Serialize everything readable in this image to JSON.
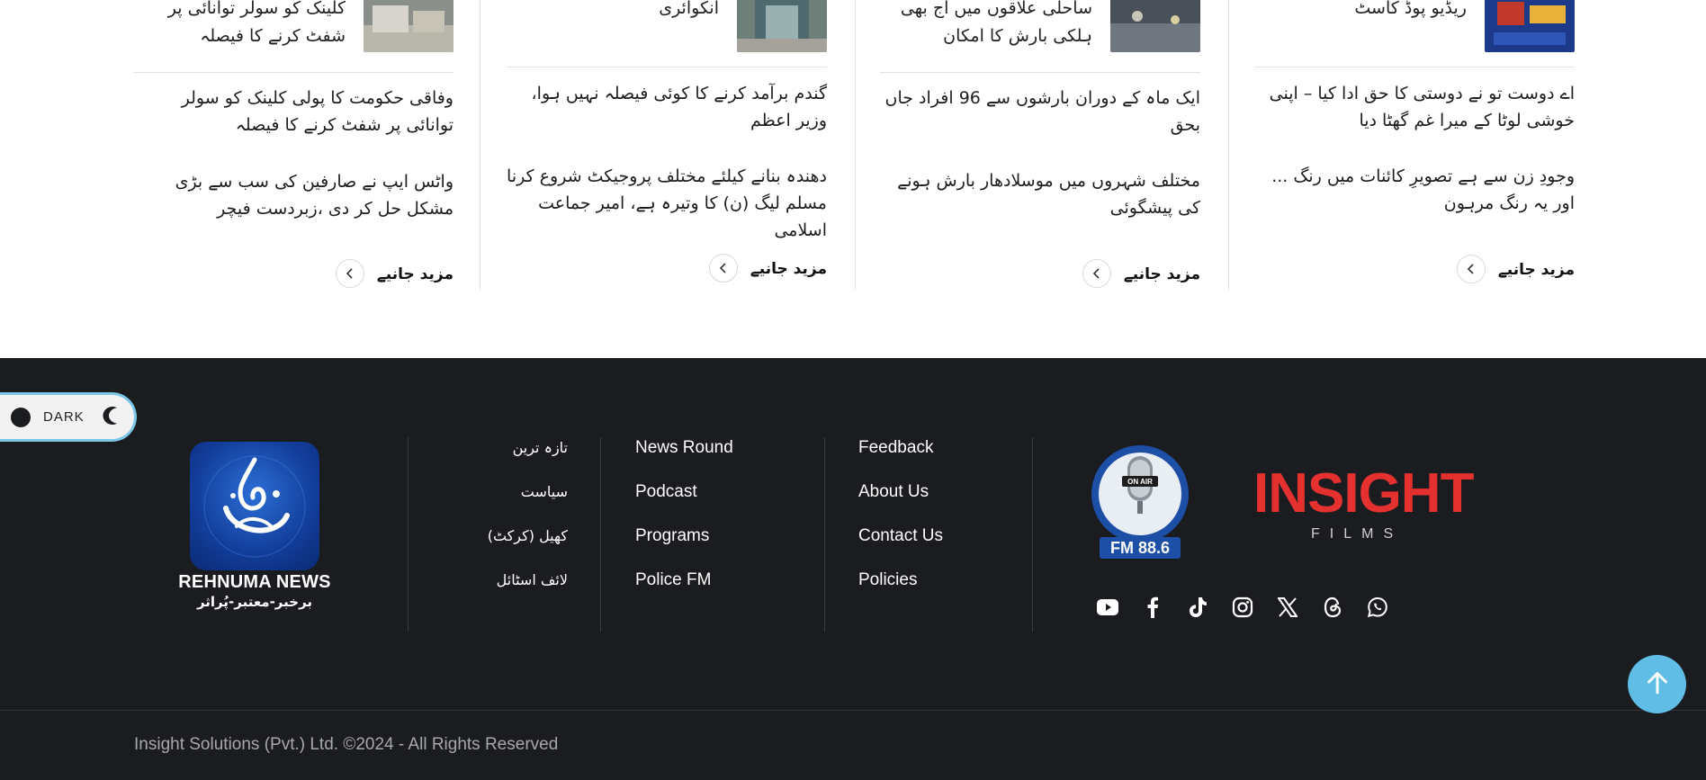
{
  "columns": [
    {
      "top_title": "کلینک کو سولر توانائی پر شفٹ کرنے کا فیصلہ",
      "stories": [
        "وفاقی حکومت کا پولی کلینک کو سولر توانائی پر شفٹ کرنے کا فیصلہ",
        "واٹس ایپ نے صارفین کی سب سے بڑی مشکل حل کر دی ،زبردست فیچر"
      ],
      "more_label": "مزید جانیے"
    },
    {
      "top_title": "انکوائری",
      "stories": [
        "گندم برآمد کرنے کا کوئی فیصلہ نہیں ہوا، وزیر اعظم",
        "دھندہ بنانے کیلئے مختلف پروجیکٹ شروع کرنا مسلم لیگ (ن) کا وتیرہ ہے، امیر جماعت اسلامی"
      ],
      "more_label": "مزید جانیے"
    },
    {
      "top_title": "ساحلی علاقوں میں آج بھی ہلکی بارش کا امکان",
      "stories": [
        "ایک ماہ کے دوران بارشوں سے 96 افراد جاں بحق",
        "مختلف شہروں میں موسلادھار بارش ہونے کی پیشگوئی"
      ],
      "more_label": "مزید جانیے"
    },
    {
      "top_title": "ریڈیو پوڈ کاسٹ",
      "stories": [
        "اے دوست تو نے دوستی کا حق ادا کیا – اپنی خوشی لوٹا کے میرا غم گھٹا دیا",
        "وجودِ زن سے ہے تصویرِ کائنات میں رنگ ... اور یہ رنگ مرہون"
      ],
      "more_label": "مزید جانیے"
    }
  ],
  "footer": {
    "dark_toggle_label": "DARK",
    "logo_name": "REHNUMA NEWS",
    "logo_tagline": "برخبر-معتبر-پُراثر",
    "urdu_links": [
      "تازہ ترین",
      "سیاست",
      "کھیل (کرکٹ)",
      "لائف اسٹائل"
    ],
    "links_a": [
      "News Round",
      "Podcast",
      "Programs",
      "Police FM"
    ],
    "links_b": [
      "Feedback",
      "About Us",
      "Contact Us",
      "Policies"
    ],
    "fm_label": "FM 88.6",
    "fm_on_air": "ON AIR",
    "insight_name": "INSIGHT",
    "insight_sub": "FILMS",
    "socials": [
      "youtube-icon",
      "facebook-icon",
      "tiktok-icon",
      "instagram-icon",
      "x-icon",
      "threads-icon",
      "whatsapp-icon"
    ],
    "copyright": "Insight Solutions (Pvt.) Ltd. ©2024 - All Rights Reserved"
  },
  "colors": {
    "footer_bg": "#1b1c20",
    "accent_blue": "#5fbde6",
    "insight_red": "#e4312f"
  }
}
